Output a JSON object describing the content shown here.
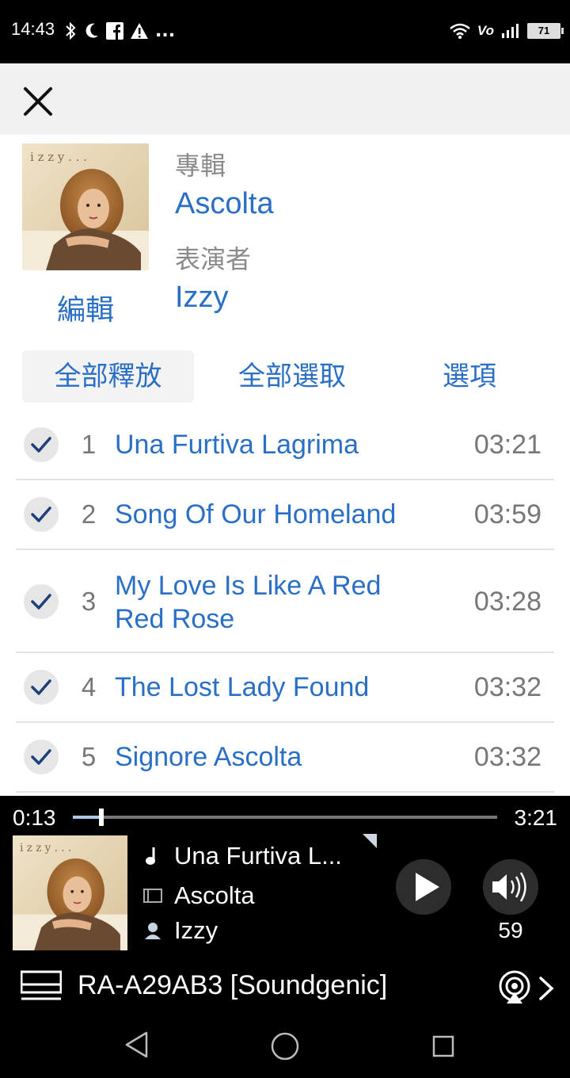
{
  "status": {
    "time": "14:43",
    "battery": "71",
    "volte": "Vo",
    "more": "..."
  },
  "album": {
    "album_label": "專輯",
    "album_name": "Ascolta",
    "artist_label": "表演者",
    "artist_name": "Izzy",
    "edit_label": "編輯",
    "cover_text": "i z z y . . ."
  },
  "actions": {
    "release_all": "全部釋放",
    "select_all": "全部選取",
    "options": "選項"
  },
  "tracks": [
    {
      "num": "1",
      "title": "Una Furtiva Lagrima",
      "duration": "03:21",
      "checked": true
    },
    {
      "num": "2",
      "title": "Song Of Our Homeland",
      "duration": "03:59",
      "checked": true
    },
    {
      "num": "3",
      "title": "My Love Is Like A Red Red Rose",
      "duration": "03:28",
      "checked": true
    },
    {
      "num": "4",
      "title": "The Lost Lady Found",
      "duration": "03:32",
      "checked": true
    },
    {
      "num": "5",
      "title": "Signore Ascolta",
      "duration": "03:32",
      "checked": true
    }
  ],
  "player": {
    "elapsed": "0:13",
    "total": "3:21",
    "progress": 0.0674,
    "now_title": "Una Furtiva L...",
    "now_album": "Ascolta",
    "now_artist": "Izzy",
    "volume": "59",
    "device": "RA-A29AB3 [Soundgenic]"
  },
  "colors": {
    "accent": "#2a6fc6",
    "header_bg": "#f1f1f1",
    "player_bg": "#000000"
  }
}
